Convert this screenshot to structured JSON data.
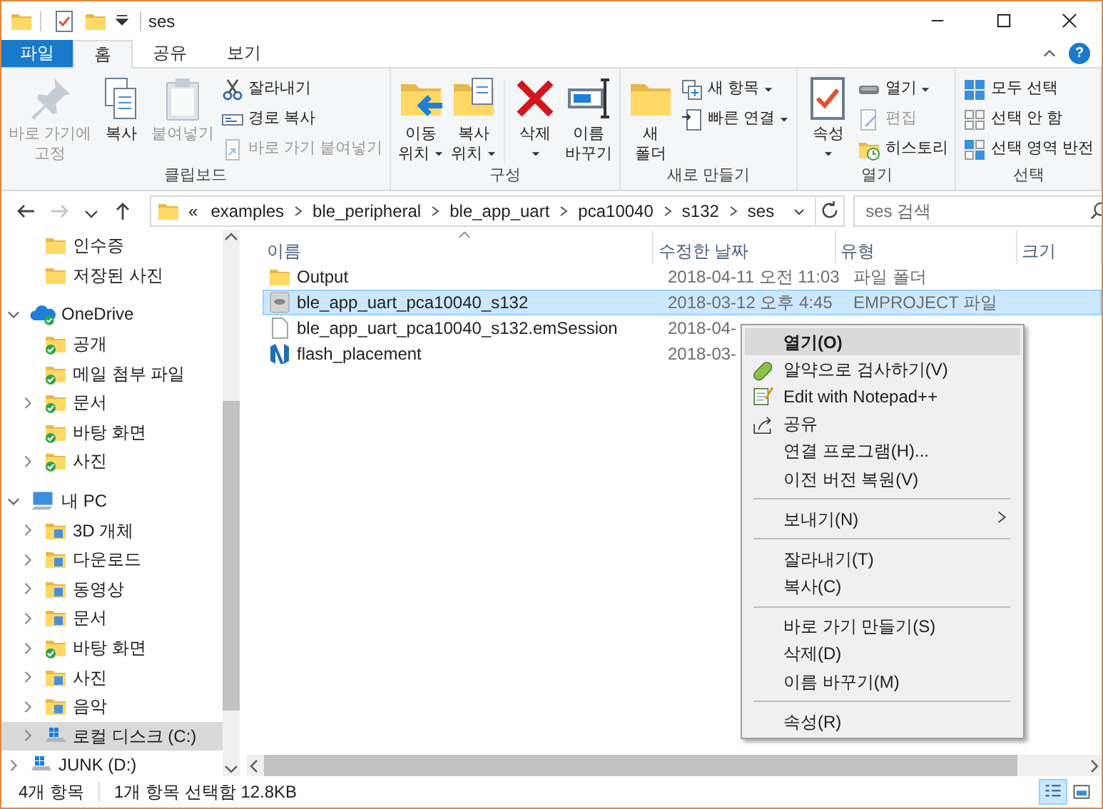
{
  "window": {
    "title": "ses"
  },
  "ribbon_tabs": [
    {
      "label": "파일",
      "kind": "file",
      "selected": false
    },
    {
      "label": "홈",
      "kind": "tab",
      "selected": true
    },
    {
      "label": "공유",
      "kind": "tab",
      "selected": false
    },
    {
      "label": "보기",
      "kind": "tab",
      "selected": false
    }
  ],
  "help_button": "?",
  "ribbon_groups": [
    {
      "label": "클립보드",
      "items": [
        {
          "kind": "large",
          "label": "바로 가기에\n고정",
          "disabled": true
        },
        {
          "kind": "large",
          "label": "복사",
          "disabled": false
        },
        {
          "kind": "large",
          "label": "붙여넣기",
          "disabled": true
        },
        {
          "kind": "stack",
          "buttons": [
            {
              "label": "잘라내기",
              "disabled": false
            },
            {
              "label": "경로 복사",
              "disabled": false
            },
            {
              "label": "바로 가기 붙여넣기",
              "disabled": true
            }
          ]
        }
      ]
    },
    {
      "label": "구성",
      "items": [
        {
          "kind": "large",
          "label": "이동\n위치",
          "disabled": false,
          "dropdown": true
        },
        {
          "kind": "large",
          "label": "복사\n위치",
          "disabled": false,
          "dropdown": true
        },
        {
          "kind": "divider"
        },
        {
          "kind": "large",
          "label": "삭제",
          "disabled": false,
          "dropdown": true
        },
        {
          "kind": "large",
          "label": "이름\n바꾸기",
          "disabled": false
        }
      ]
    },
    {
      "label": "새로 만들기",
      "items": [
        {
          "kind": "large",
          "label": "새\n폴더",
          "disabled": false
        },
        {
          "kind": "stack",
          "buttons": [
            {
              "label": "새 항목",
              "disabled": false,
              "dropdown": true
            },
            {
              "label": "빠른 연결",
              "disabled": false,
              "dropdown": true
            }
          ]
        }
      ]
    },
    {
      "label": "열기",
      "items": [
        {
          "kind": "large",
          "label": "속성",
          "disabled": false,
          "dropdown": true
        },
        {
          "kind": "stack",
          "buttons": [
            {
              "label": "열기",
              "disabled": false,
              "dropdown": true
            },
            {
              "label": "편집",
              "disabled": true
            },
            {
              "label": "히스토리",
              "disabled": false
            }
          ]
        }
      ]
    },
    {
      "label": "선택",
      "items": [
        {
          "kind": "stack",
          "buttons": [
            {
              "label": "모두 선택",
              "disabled": false
            },
            {
              "label": "선택 안 함",
              "disabled": false
            },
            {
              "label": "선택 영역 반전",
              "disabled": false
            }
          ]
        }
      ]
    }
  ],
  "nav_buttons": [
    {
      "kind": "back",
      "disabled": false
    },
    {
      "kind": "forward",
      "disabled": true
    },
    {
      "kind": "recent",
      "disabled": false
    },
    {
      "kind": "up",
      "disabled": false
    }
  ],
  "address": {
    "overflow": "«",
    "path": [
      "examples",
      "ble_peripheral",
      "ble_app_uart",
      "pca10040",
      "s132",
      "ses"
    ]
  },
  "search": {
    "placeholder": "ses 검색"
  },
  "nav_pane": {
    "items": [
      {
        "label": "인수증",
        "kind": "pinned-folder",
        "selected": false
      },
      {
        "label": "저장된 사진",
        "kind": "pinned-folder",
        "selected": false
      },
      {
        "label": "OneDrive",
        "kind": "cloud",
        "selected": false,
        "expanded": true,
        "children": [
          {
            "label": "공개",
            "kind": "synced-folder",
            "selected": false
          },
          {
            "label": "메일 첨부 파일",
            "kind": "synced-folder",
            "selected": false
          },
          {
            "label": "문서",
            "kind": "synced-folder",
            "selected": false,
            "expanded": false
          },
          {
            "label": "바탕 화면",
            "kind": "synced-folder",
            "selected": false
          },
          {
            "label": "사진",
            "kind": "synced-folder",
            "selected": false,
            "expanded": false
          }
        ]
      },
      {
        "label": "내 PC",
        "kind": "computer",
        "selected": false,
        "expanded": true,
        "children": [
          {
            "label": "3D 개체",
            "kind": "special-folder",
            "selected": false,
            "expanded": false
          },
          {
            "label": "다운로드",
            "kind": "special-folder",
            "selected": false,
            "expanded": false
          },
          {
            "label": "동영상",
            "kind": "special-folder",
            "selected": false,
            "expanded": false
          },
          {
            "label": "문서",
            "kind": "special-folder",
            "selected": false,
            "expanded": false
          },
          {
            "label": "바탕 화면",
            "kind": "synced-folder",
            "selected": false,
            "expanded": false
          },
          {
            "label": "사진",
            "kind": "special-folder",
            "selected": false,
            "expanded": false
          },
          {
            "label": "음악",
            "kind": "special-folder",
            "selected": false,
            "expanded": false
          },
          {
            "label": "로컬 디스크 (C:)",
            "kind": "drive",
            "selected": true,
            "expanded": false
          }
        ]
      },
      {
        "label": "JUNK (D:)",
        "kind": "drive",
        "selected": false,
        "expanded": false
      }
    ]
  },
  "file_list": {
    "columns": [
      {
        "label": "이름",
        "sorted": true
      },
      {
        "label": "수정한 날짜",
        "sorted": false
      },
      {
        "label": "유형",
        "sorted": false
      },
      {
        "label": "크기",
        "sorted": false
      }
    ],
    "rows": [
      {
        "kind": "folder",
        "name": "Output",
        "date": "2018-04-11 오전 11:03",
        "type": "파일 폴더",
        "selected": false
      },
      {
        "kind": "project",
        "name": "ble_app_uart_pca10040_s132",
        "date": "2018-03-12 오후 4:45",
        "type": "EMPROJECT 파일",
        "selected": true
      },
      {
        "kind": "document",
        "name": "ble_app_uart_pca10040_s132.emSession",
        "date": "2018-04-",
        "selected": false
      },
      {
        "kind": "app",
        "name": "flash_placement",
        "date": "2018-03-",
        "selected": false
      }
    ]
  },
  "context_menu": {
    "items": [
      {
        "kind": "item",
        "label": "열기(O)",
        "default": true,
        "selected": true
      },
      {
        "kind": "item",
        "label": "알약으로 검사하기(V)",
        "default": false,
        "selected": false
      },
      {
        "kind": "item",
        "label": "Edit with Notepad++",
        "default": false,
        "selected": false
      },
      {
        "kind": "item",
        "label": "공유",
        "default": false,
        "selected": false
      },
      {
        "kind": "item",
        "label": "연결 프로그램(H)...",
        "default": false,
        "selected": false
      },
      {
        "kind": "item",
        "label": "이전 버전 복원(V)",
        "default": false,
        "selected": false
      },
      {
        "kind": "separator"
      },
      {
        "kind": "item",
        "label": "보내기(N)",
        "default": false,
        "selected": false,
        "submenu": true
      },
      {
        "kind": "separator"
      },
      {
        "kind": "item",
        "label": "잘라내기(T)",
        "default": false,
        "selected": false
      },
      {
        "kind": "item",
        "label": "복사(C)",
        "default": false,
        "selected": false
      },
      {
        "kind": "separator"
      },
      {
        "kind": "item",
        "label": "바로 가기 만들기(S)",
        "default": false,
        "selected": false
      },
      {
        "kind": "item",
        "label": "삭제(D)",
        "default": false,
        "selected": false
      },
      {
        "kind": "item",
        "label": "이름 바꾸기(M)",
        "default": false,
        "selected": false
      },
      {
        "kind": "separator"
      },
      {
        "kind": "item",
        "label": "속성(R)",
        "default": false,
        "selected": false
      }
    ]
  },
  "status_bar": {
    "item_count": "4개 항목",
    "selection": "1개 항목 선택함 12.8KB",
    "views": [
      {
        "kind": "details",
        "selected": true
      },
      {
        "kind": "large-icons",
        "selected": false
      }
    ]
  }
}
